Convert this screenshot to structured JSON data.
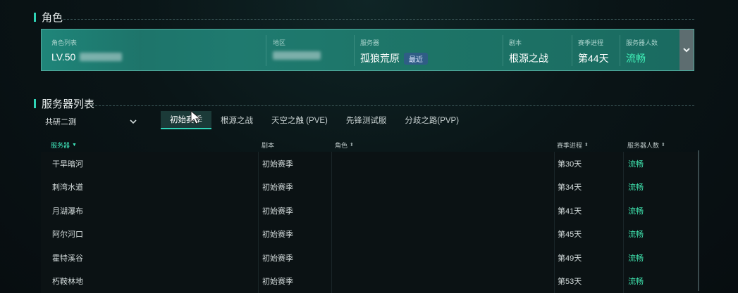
{
  "role_section": {
    "title": "角色"
  },
  "role_card": {
    "list_label": "角色列表",
    "level": "LV.50",
    "region_label": "地区",
    "server_label": "服务器",
    "server_value": "孤狼荒原",
    "recent_tag": "最近",
    "script_label": "剧本",
    "script_value": "根源之战",
    "season_label": "赛季进程",
    "season_value": "第44天",
    "population_label": "服务器人数",
    "population_value": "流畅",
    "expand_icon": "chevron-down-icon"
  },
  "server_section": {
    "title": "服务器列表"
  },
  "region_select": {
    "value": "共研二测"
  },
  "tabs": [
    {
      "label": "初始赛季",
      "active": true
    },
    {
      "label": "根源之战",
      "active": false
    },
    {
      "label": "天空之触 (PVE)",
      "active": false
    },
    {
      "label": "先锋测试服",
      "active": false
    },
    {
      "label": "分歧之路(PVP)",
      "active": false
    }
  ],
  "table": {
    "headers": {
      "server": "服务器",
      "script": "剧本",
      "role": "角色",
      "season": "赛季进程",
      "population": "服务器人数"
    },
    "rows": [
      {
        "server": "干旱暗河",
        "script": "初始赛季",
        "role": "",
        "season": "第30天",
        "population": "流畅"
      },
      {
        "server": "刺湾水道",
        "script": "初始赛季",
        "role": "",
        "season": "第34天",
        "population": "流畅"
      },
      {
        "server": "月湖瀑布",
        "script": "初始赛季",
        "role": "",
        "season": "第41天",
        "population": "流畅"
      },
      {
        "server": "阿尔河口",
        "script": "初始赛季",
        "role": "",
        "season": "第45天",
        "population": "流畅"
      },
      {
        "server": "霍特溪谷",
        "script": "初始赛季",
        "role": "",
        "season": "第49天",
        "population": "流畅"
      },
      {
        "server": "朽鞍林地",
        "script": "初始赛季",
        "role": "",
        "season": "第53天",
        "population": "流畅"
      }
    ]
  },
  "colors": {
    "accent": "#2fd3b6",
    "status_green": "#40e6b0",
    "card_bg": "#1d7467"
  }
}
